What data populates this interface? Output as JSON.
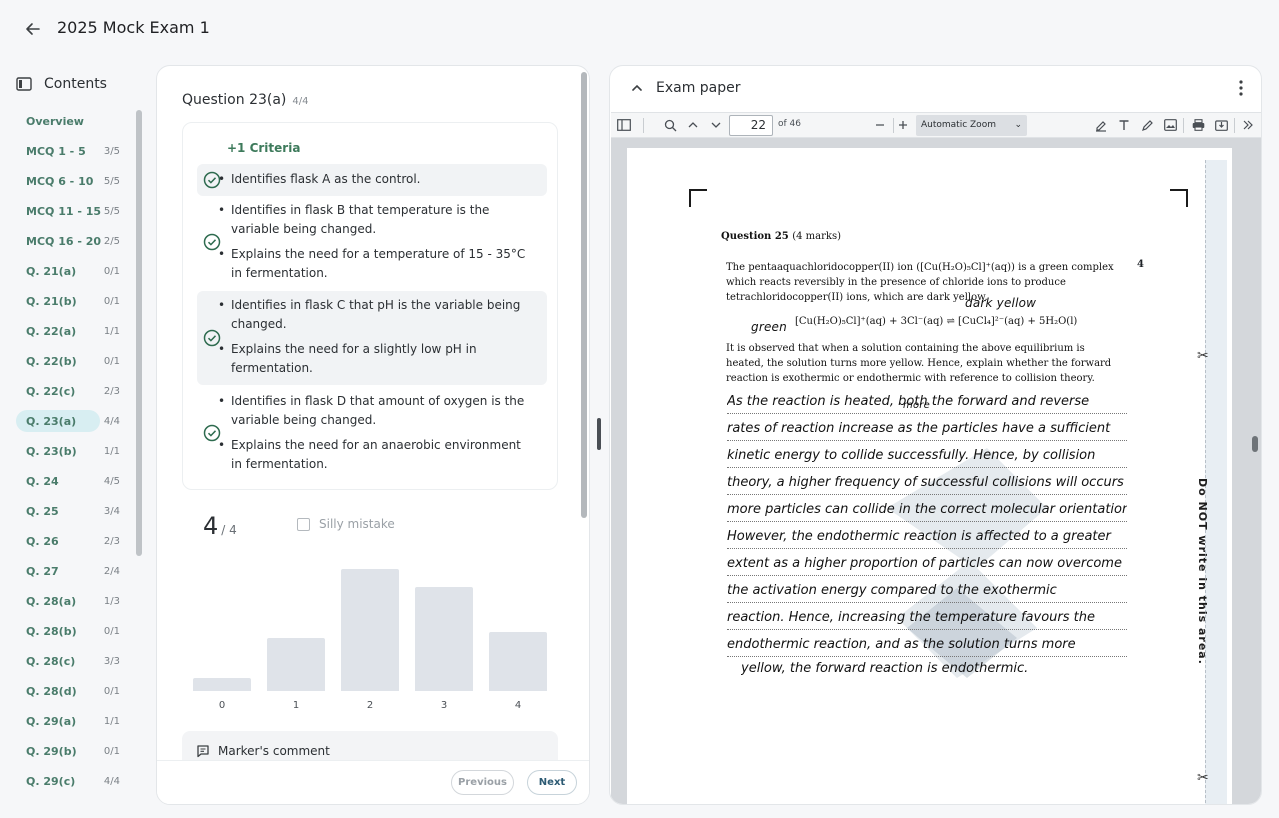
{
  "header": {
    "title": "2025 Mock Exam 1"
  },
  "contents": {
    "label": "Contents",
    "items": [
      {
        "label": "Overview",
        "score": ""
      },
      {
        "label": "MCQ 1 - 5",
        "score": "3/5"
      },
      {
        "label": "MCQ 6 - 10",
        "score": "5/5"
      },
      {
        "label": "MCQ 11 - 15",
        "score": "5/5"
      },
      {
        "label": "MCQ 16 - 20",
        "score": "2/5"
      },
      {
        "label": "Q. 21(a)",
        "score": "0/1"
      },
      {
        "label": "Q. 21(b)",
        "score": "0/1"
      },
      {
        "label": "Q. 22(a)",
        "score": "1/1"
      },
      {
        "label": "Q. 22(b)",
        "score": "0/1"
      },
      {
        "label": "Q. 22(c)",
        "score": "2/3"
      },
      {
        "label": "Q. 23(a)",
        "score": "4/4"
      },
      {
        "label": "Q. 23(b)",
        "score": "1/1"
      },
      {
        "label": "Q. 24",
        "score": "4/5"
      },
      {
        "label": "Q. 25",
        "score": "3/4"
      },
      {
        "label": "Q. 26",
        "score": "2/3"
      },
      {
        "label": "Q. 27",
        "score": "2/4"
      },
      {
        "label": "Q. 28(a)",
        "score": "1/3"
      },
      {
        "label": "Q. 28(b)",
        "score": "0/1"
      },
      {
        "label": "Q. 28(c)",
        "score": "3/3"
      },
      {
        "label": "Q. 28(d)",
        "score": "0/1"
      },
      {
        "label": "Q. 29(a)",
        "score": "1/1"
      },
      {
        "label": "Q. 29(b)",
        "score": "0/1"
      },
      {
        "label": "Q. 29(c)",
        "score": "4/4"
      }
    ]
  },
  "question": {
    "title": "Question 23(a)",
    "subscore": "4/4",
    "criteria_heading": "+1 Criteria",
    "criteria": [
      "Identifies flask A as the control.",
      "Identifies in flask B that temperature is the variable being changed.",
      "Explains the need for a temperature of 15 - 35°C in fermentation.",
      "Identifies in flask C that pH is the variable being changed.",
      "Explains the need for a slightly low pH in fermentation.",
      "Identifies in flask D that amount of oxygen is the variable being changed.",
      "Explains the need for an anaerobic environment in fermentation."
    ],
    "score": "4",
    "score_of": "/ 4",
    "silly_mistake": "Silly mistake",
    "markers_comment": "Marker's comment",
    "prev": "Previous",
    "next": "Next"
  },
  "chart_data": {
    "type": "bar",
    "categories": [
      "0",
      "1",
      "2",
      "3",
      "4"
    ],
    "values": [
      2,
      8.5,
      19.5,
      16.7,
      9.5
    ],
    "ylim": [
      0,
      20
    ]
  },
  "exam_paper": {
    "title": "Exam paper",
    "page": "22",
    "of_pages": "of 46",
    "zoom": "Automatic Zoom",
    "question_heading": "Question 25",
    "question_marks": "(4 marks)",
    "mark": "4",
    "intro": "The pentaaquachloridocopper(II) ion ([Cu(H₂O)₅Cl]⁺(aq)) is a green complex which reacts reversibly in the presence of chloride ions to produce tetrachloridocopper(II) ions, which are dark yellow.",
    "annot_green": "green",
    "annot_dark_yellow": "dark yellow",
    "equation": "[Cu(H₂O)₅Cl]⁺(aq) + 3Cl⁻(aq) ⇌ [CuCl₄]²⁻(aq) + 5H₂O(l)",
    "prompt": "It is observed that when a solution containing the above equilibrium is heated, the solution turns more yellow. Hence, explain whether the forward reaction is exothermic or endothermic with reference to collision theory.",
    "answer_more": "more",
    "answer_lines": [
      "As the reaction is heated, both the forward and reverse",
      "rates of reaction increase as the particles have a sufficient",
      "kinetic energy to collide successfully. Hence, by collision",
      "theory, a higher frequency of successful collisions will occurs",
      "more particles can collide in the correct molecular orientation.",
      "However, the endothermic reaction is affected to a greater",
      "extent as a higher proportion of particles can now overcome",
      "the activation energy compared to the exothermic",
      "reaction. Hence, increasing the temperature favours the",
      "endothermic reaction, and as the solution turns more",
      "yellow, the forward reaction is endothermic."
    ],
    "margin_note": "Do NOT write in this area."
  }
}
